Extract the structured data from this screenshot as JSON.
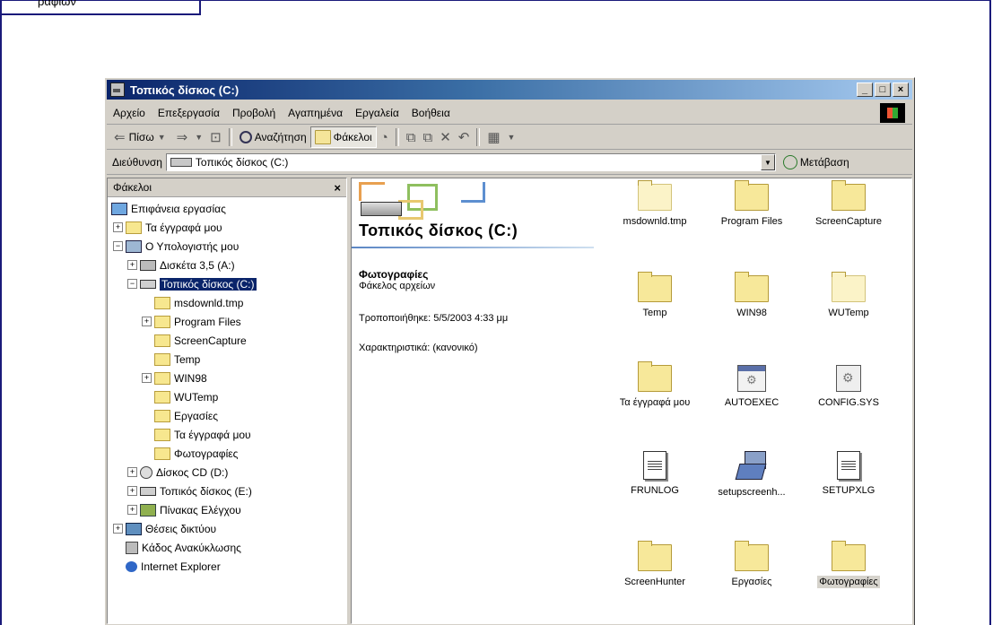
{
  "top_fragment": "ραφιών",
  "window": {
    "title": "Τοπικός δίσκος (C:)",
    "title_buttons": [
      "_",
      "□",
      "×"
    ]
  },
  "menu": [
    "Αρχείο",
    "Επεξεργασία",
    "Προβολή",
    "Αγαπημένα",
    "Εργαλεία",
    "Βοήθεια"
  ],
  "toolbar": {
    "back": "Πίσω",
    "search": "Αναζήτηση",
    "folders": "Φάκελοι"
  },
  "address": {
    "label": "Διεύθυνση",
    "value": "Τοπικός δίσκος (C:)",
    "go": "Μετάβαση"
  },
  "folders_pane": {
    "title": "Φάκελοι",
    "close": "×",
    "tree": [
      {
        "label": "Επιφάνεια εργασίας",
        "expander": ""
      },
      {
        "label": "Τα έγγραφά μου",
        "expander": "+"
      },
      {
        "label": "Ο Υπολογιστής μου",
        "expander": "−"
      },
      {
        "label": "Δισκέτα 3,5 (A:)",
        "expander": "+"
      },
      {
        "label": "Τοπικός δίσκος (C:)",
        "expander": "−"
      },
      {
        "label": "msdownld.tmp",
        "expander": ""
      },
      {
        "label": "Program Files",
        "expander": "+"
      },
      {
        "label": "ScreenCapture",
        "expander": ""
      },
      {
        "label": "Temp",
        "expander": ""
      },
      {
        "label": "WIN98",
        "expander": "+"
      },
      {
        "label": "WUTemp",
        "expander": ""
      },
      {
        "label": "Εργασίες",
        "expander": ""
      },
      {
        "label": "Τα έγγραφά μου",
        "expander": ""
      },
      {
        "label": "Φωτογραφίες",
        "expander": ""
      },
      {
        "label": "Δίσκος CD (D:)",
        "expander": "+"
      },
      {
        "label": "Τοπικός δίσκος (E:)",
        "expander": "+"
      },
      {
        "label": "Πίνακας Ελέγχου",
        "expander": "+"
      },
      {
        "label": "Θέσεις δικτύου",
        "expander": "+"
      },
      {
        "label": "Κάδος Ανακύκλωσης",
        "expander": ""
      },
      {
        "label": "Internet Explorer",
        "expander": ""
      }
    ]
  },
  "details": {
    "drive_title": "Τοπικός δίσκος (C:)",
    "selected_name": "Φωτογραφίες",
    "selected_type": "Φάκελος αρχείων",
    "modified": "Τροποποιήθηκε: 5/5/2003 4:33 μμ",
    "attributes": "Χαρακτηριστικά: (κανονικό)"
  },
  "files": [
    {
      "name": "msdownld.tmp",
      "icon": "folder-pale"
    },
    {
      "name": "Program Files",
      "icon": "folder"
    },
    {
      "name": "ScreenCapture",
      "icon": "folder"
    },
    {
      "name": "Temp",
      "icon": "folder"
    },
    {
      "name": "WIN98",
      "icon": "folder"
    },
    {
      "name": "WUTemp",
      "icon": "folder-pale"
    },
    {
      "name": "Τα έγγραφά μου",
      "icon": "folder"
    },
    {
      "name": "AUTOEXEC",
      "icon": "batch-file"
    },
    {
      "name": "CONFIG.SYS",
      "icon": "system-file"
    },
    {
      "name": "FRUNLOG",
      "icon": "text-document"
    },
    {
      "name": "setupscreenh...",
      "icon": "setup-program"
    },
    {
      "name": "SETUPXLG",
      "icon": "text-document"
    },
    {
      "name": "ScreenHunter",
      "icon": "folder"
    },
    {
      "name": "Εργασίες",
      "icon": "folder"
    },
    {
      "name": "Φωτογραφίες",
      "icon": "folder"
    }
  ]
}
